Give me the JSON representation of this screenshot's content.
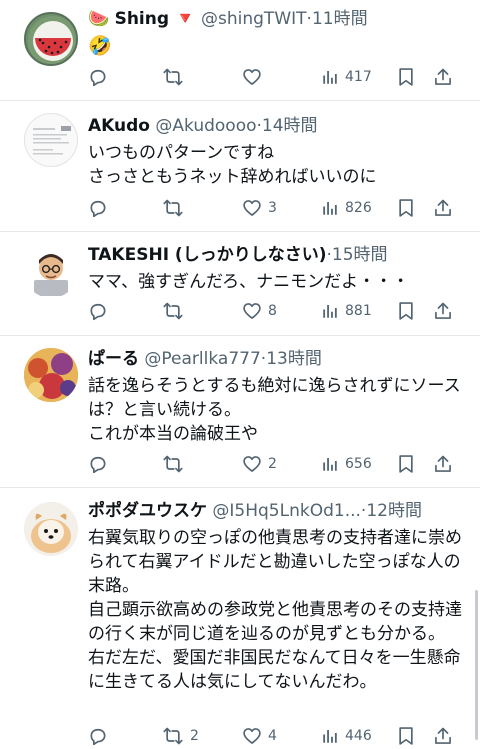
{
  "posts": [
    {
      "name": "Shing",
      "name_emoji": "🍉",
      "badge_emoji": "🔻",
      "handle": "@shingTWIT",
      "time": "11時間",
      "text": "🤣",
      "replies": "",
      "reposts": "",
      "likes": "",
      "views": "417"
    },
    {
      "name": "AKudo",
      "handle": "@Akudoooo",
      "time": "14時間",
      "text": "いつものパターンですね\nさっさともうネット辞めればいいのに",
      "replies": "",
      "reposts": "",
      "likes": "3",
      "views": "826"
    },
    {
      "name": "TAKESHI (しっかりしなさい)",
      "handle": "",
      "time": "15時間",
      "text": "ママ、強すぎんだろ、ナニモンだよ・・・",
      "replies": "",
      "reposts": "",
      "likes": "8",
      "views": "881"
    },
    {
      "name": "ぱーる",
      "handle": "@Pearllka777",
      "time": "13時間",
      "text": "話を逸らそうとするも絶対に逸らされずにソースは？と言い続ける。\nこれが本当の論破王や",
      "replies": "",
      "reposts": "",
      "likes": "2",
      "views": "656"
    },
    {
      "name": "ポポダユウスケ",
      "handle": "@I5Hq5LnkOd1...",
      "time": "12時間",
      "text": "右翼気取りの空っぽの他責思考の支持者達に崇められて右翼アイドルだと勘違いした空っぽな人の末路。\n自己顕示欲高めの参政党と他責思考のその支持達の行く末が同じ道を辿るのが見ずとも分かる。\n右だ左だ、愛国だ非国民だなんて日々を一生懸命に生きてる人は気にしてないんだわ。",
      "replies": "",
      "reposts": "2",
      "likes": "4",
      "views": "446"
    }
  ],
  "colors": {
    "text": "#0f1419",
    "muted": "#536471",
    "divider": "#e6e9ec"
  },
  "icons": [
    "reply-icon",
    "repost-icon",
    "like-icon",
    "views-icon",
    "bookmark-icon",
    "share-icon"
  ]
}
